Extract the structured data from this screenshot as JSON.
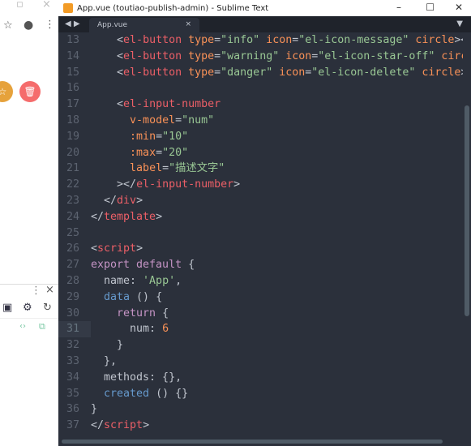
{
  "browser": {
    "icons": [
      "window-restore-icon",
      "close-icon",
      "star-icon",
      "account-icon",
      "more-icon",
      "warning-star-button",
      "danger-delete-button",
      "devtools-more-icon",
      "devtools-close-icon",
      "bar-chart-icon",
      "settings-icon",
      "refresh-icon",
      "code-icon",
      "external-link-icon"
    ],
    "colors": {
      "warning": "#e6a23c",
      "danger": "#f56c6c"
    }
  },
  "window": {
    "title": "App.vue (toutiao-publish-admin) - Sublime Text",
    "tab": "App.vue",
    "tab_close": "×"
  },
  "editor": {
    "current_line": 31,
    "lines": [
      {
        "n": "13",
        "t": [
          [
            "    ",
            "tx"
          ],
          [
            "<",
            "pun"
          ],
          [
            "el-button",
            "tag"
          ],
          [
            " type",
            "attr"
          ],
          [
            "=",
            "pun"
          ],
          [
            "\"info\"",
            "str"
          ],
          [
            " icon",
            "attr"
          ],
          [
            "=",
            "pun"
          ],
          [
            "\"el-icon-message\"",
            "str"
          ],
          [
            " circle",
            "attr"
          ],
          [
            "><",
            "pun"
          ]
        ]
      },
      {
        "n": "14",
        "t": [
          [
            "    ",
            "tx"
          ],
          [
            "<",
            "pun"
          ],
          [
            "el-button",
            "tag"
          ],
          [
            " type",
            "attr"
          ],
          [
            "=",
            "pun"
          ],
          [
            "\"warning\"",
            "str"
          ],
          [
            " icon",
            "attr"
          ],
          [
            "=",
            "pun"
          ],
          [
            "\"el-icon-star-off\"",
            "str"
          ],
          [
            " circ",
            "attr"
          ]
        ]
      },
      {
        "n": "15",
        "t": [
          [
            "    ",
            "tx"
          ],
          [
            "<",
            "pun"
          ],
          [
            "el-button",
            "tag"
          ],
          [
            " type",
            "attr"
          ],
          [
            "=",
            "pun"
          ],
          [
            "\"danger\"",
            "str"
          ],
          [
            " icon",
            "attr"
          ],
          [
            "=",
            "pun"
          ],
          [
            "\"el-icon-delete\"",
            "str"
          ],
          [
            " circle",
            "attr"
          ],
          [
            ">",
            "pun"
          ]
        ]
      },
      {
        "n": "16",
        "t": []
      },
      {
        "n": "17",
        "t": [
          [
            "    ",
            "tx"
          ],
          [
            "<",
            "pun"
          ],
          [
            "el-input-number",
            "tag"
          ]
        ]
      },
      {
        "n": "18",
        "t": [
          [
            "      ",
            "tx"
          ],
          [
            "v-model",
            "attr"
          ],
          [
            "=",
            "pun"
          ],
          [
            "\"num\"",
            "str"
          ]
        ]
      },
      {
        "n": "19",
        "t": [
          [
            "      ",
            "tx"
          ],
          [
            ":min",
            "attr"
          ],
          [
            "=",
            "pun"
          ],
          [
            "\"10\"",
            "str"
          ]
        ]
      },
      {
        "n": "20",
        "t": [
          [
            "      ",
            "tx"
          ],
          [
            ":max",
            "attr"
          ],
          [
            "=",
            "pun"
          ],
          [
            "\"20\"",
            "str"
          ]
        ]
      },
      {
        "n": "21",
        "t": [
          [
            "      ",
            "tx"
          ],
          [
            "label",
            "attr"
          ],
          [
            "=",
            "pun"
          ],
          [
            "\"描述文字\"",
            "str"
          ]
        ]
      },
      {
        "n": "22",
        "t": [
          [
            "    ",
            "tx"
          ],
          [
            "></",
            "pun"
          ],
          [
            "el-input-number",
            "tag"
          ],
          [
            ">",
            "pun"
          ]
        ]
      },
      {
        "n": "23",
        "t": [
          [
            "  ",
            "tx"
          ],
          [
            "</",
            "pun"
          ],
          [
            "div",
            "tag"
          ],
          [
            ">",
            "pun"
          ]
        ]
      },
      {
        "n": "24",
        "t": [
          [
            "</",
            "pun"
          ],
          [
            "template",
            "tag"
          ],
          [
            ">",
            "pun"
          ]
        ]
      },
      {
        "n": "25",
        "t": []
      },
      {
        "n": "26",
        "t": [
          [
            "<",
            "pun"
          ],
          [
            "script",
            "tag"
          ],
          [
            ">",
            "pun"
          ]
        ]
      },
      {
        "n": "27",
        "t": [
          [
            "export default",
            "kw"
          ],
          [
            " {",
            "pun"
          ]
        ]
      },
      {
        "n": "28",
        "t": [
          [
            "  name: ",
            "tx"
          ],
          [
            "'App'",
            "str"
          ],
          [
            ",",
            "pun"
          ]
        ]
      },
      {
        "n": "29",
        "t": [
          [
            "  ",
            "tx"
          ],
          [
            "data",
            "fn"
          ],
          [
            " () {",
            "pun"
          ]
        ]
      },
      {
        "n": "30",
        "t": [
          [
            "    ",
            "tx"
          ],
          [
            "return",
            "kw"
          ],
          [
            " {",
            "pun"
          ]
        ]
      },
      {
        "n": "31",
        "t": [
          [
            "      num: ",
            "tx"
          ],
          [
            "6",
            "nm"
          ]
        ]
      },
      {
        "n": "32",
        "t": [
          [
            "    }",
            "pun"
          ]
        ]
      },
      {
        "n": "33",
        "t": [
          [
            "  },",
            "pun"
          ]
        ]
      },
      {
        "n": "34",
        "t": [
          [
            "  methods: {},",
            "tx"
          ]
        ]
      },
      {
        "n": "35",
        "t": [
          [
            "  ",
            "tx"
          ],
          [
            "created",
            "fn"
          ],
          [
            " () {}",
            "pun"
          ]
        ]
      },
      {
        "n": "36",
        "t": [
          [
            "}",
            "pun"
          ]
        ]
      },
      {
        "n": "37",
        "t": [
          [
            "</",
            "pun"
          ],
          [
            "script",
            "tag"
          ],
          [
            ">",
            "pun"
          ]
        ]
      }
    ]
  }
}
